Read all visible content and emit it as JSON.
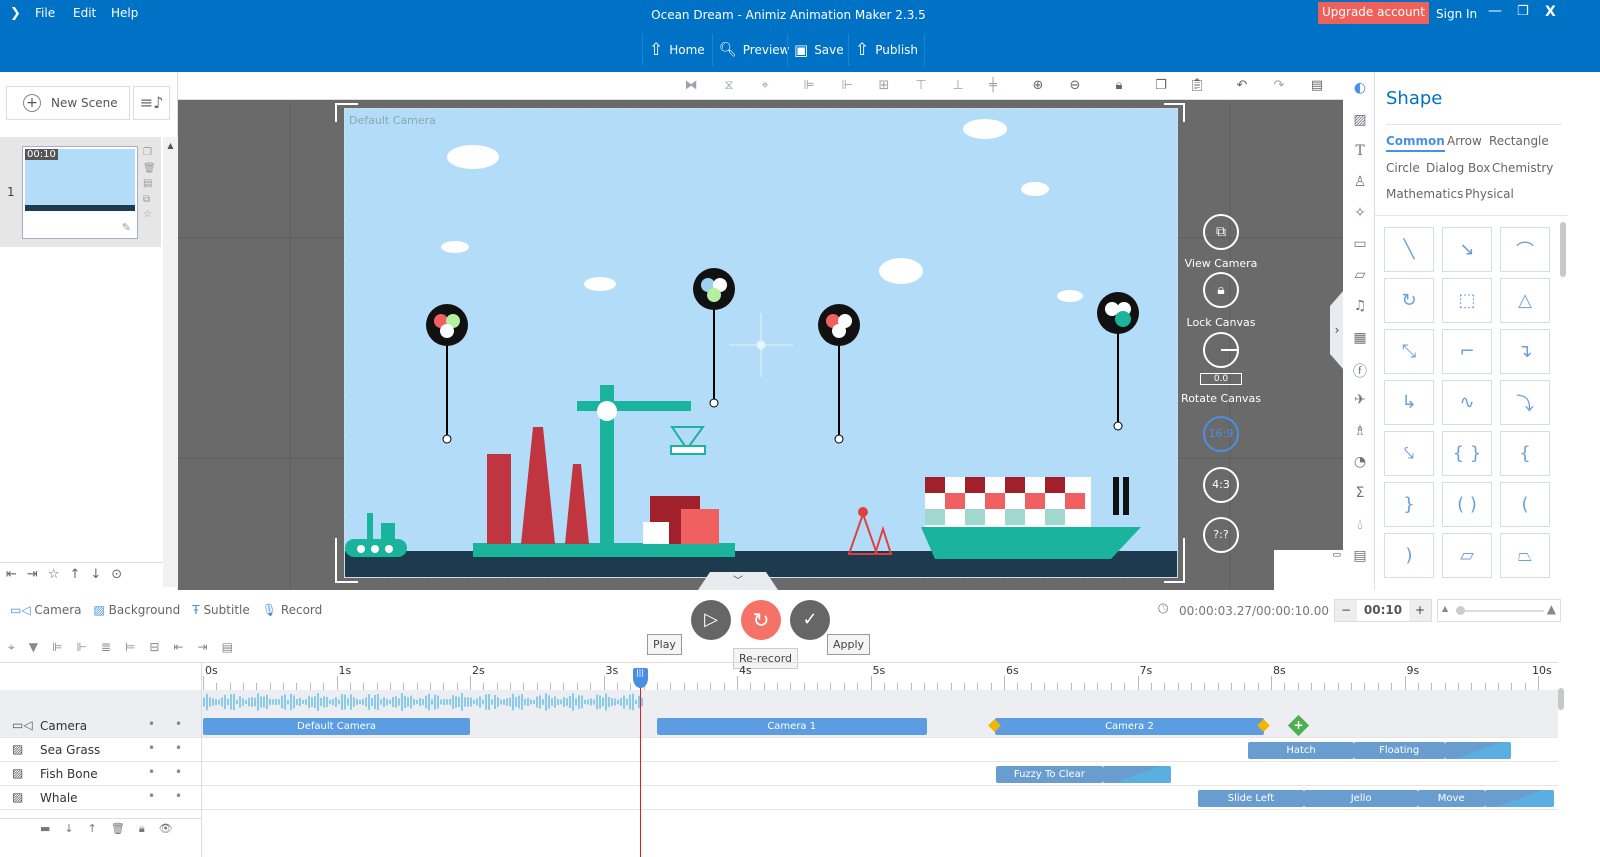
{
  "titlebar": {
    "app_title": "Ocean Dream - Animiz Animation Maker 2.3.5",
    "menu": [
      "File",
      "Edit",
      "Help"
    ],
    "upgrade": "Upgrade account",
    "sign_in": "Sign In",
    "nav": [
      {
        "label": "Home",
        "icon": "home-icon"
      },
      {
        "label": "Preview",
        "icon": "preview-icon"
      },
      {
        "label": "Save",
        "icon": "save-icon"
      },
      {
        "label": "Publish",
        "icon": "publish-icon"
      }
    ],
    "upgrade_color": "#f0605a",
    "bar_color": "#0072c6"
  },
  "left": {
    "new_scene": "New Scene",
    "scenes": [
      {
        "index": "1",
        "duration": "00:10"
      }
    ]
  },
  "stage": {
    "camera_label": "Default Camera",
    "controls": {
      "view_camera": "View Camera",
      "lock_canvas": "Lock Canvas",
      "rotate_value": "0.0",
      "rotate_canvas": "Rotate Canvas",
      "ratio_16_9": "16:9",
      "ratio_4_3": "4:3",
      "ratio_custom": "?:?"
    }
  },
  "right": {
    "title": "Shape",
    "tabs": [
      "Common",
      "Arrow",
      "Rectangle",
      "Circle",
      "Dialog Box",
      "Chemistry",
      "Mathematics",
      "Physical"
    ],
    "active_tab": "Common",
    "shapes": [
      "╲",
      "↘",
      "⌒",
      "↻",
      "⬚",
      "△",
      "⤡",
      "⌐",
      "↴",
      "↳",
      "∿",
      "⤵",
      "⤥",
      "{ }",
      "{",
      "}",
      "( )",
      "(",
      ")",
      "▱",
      "⏢"
    ]
  },
  "bottom": {
    "tools": [
      "Camera",
      "Background",
      "Subtitle",
      "Record"
    ],
    "tooltips": {
      "play": "Play",
      "rerecord": "Re-record",
      "apply": "Apply"
    },
    "time": "00:00:03.27/00:00:10.00",
    "duration": "00:10",
    "ruler": [
      "0s",
      "1s",
      "2s",
      "3s",
      "4s",
      "5s",
      "6s",
      "7s",
      "8s",
      "9s",
      "10s"
    ],
    "playhead_seconds": 3.27,
    "tracks": [
      {
        "name": "Camera",
        "icon": "camera-icon",
        "clips": [
          {
            "label": "Default Camera",
            "start": 0,
            "end": 2
          },
          {
            "label": "Camera 1",
            "start": 3.4,
            "end": 5.42
          },
          {
            "label": "Camera 2",
            "start": 5.93,
            "end": 7.95
          }
        ]
      },
      {
        "name": "Sea Grass",
        "icon": "image-icon",
        "clips": [
          {
            "label": "Hatch",
            "start": 7.83,
            "end": 8.62
          },
          {
            "label": "Floating",
            "start": 8.62,
            "end": 9.3
          },
          {
            "label": "",
            "start": 9.3,
            "end": 9.8
          }
        ]
      },
      {
        "name": "Fish Bone",
        "icon": "image-icon",
        "clips": [
          {
            "label": "Fuzzy To Clear",
            "start": 5.94,
            "end": 6.74
          },
          {
            "label": "",
            "start": 6.74,
            "end": 7.25
          }
        ]
      },
      {
        "name": "Whale",
        "icon": "image-icon",
        "clips": [
          {
            "label": "Slide Left",
            "start": 7.45,
            "end": 8.25
          },
          {
            "label": "Jello",
            "start": 8.25,
            "end": 9.1
          },
          {
            "label": "Move",
            "start": 9.1,
            "end": 9.6
          },
          {
            "label": "",
            "start": 9.6,
            "end": 10.12
          }
        ]
      }
    ]
  }
}
